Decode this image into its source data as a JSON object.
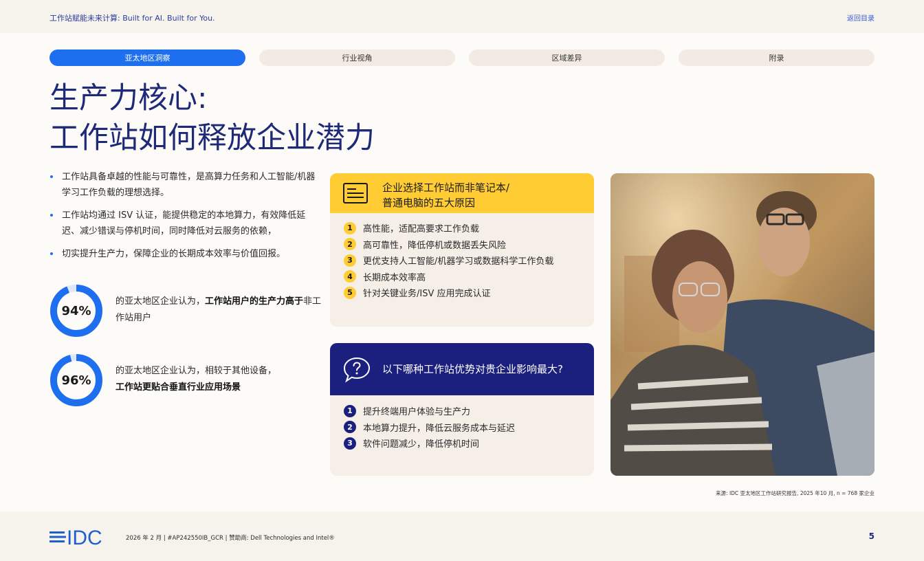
{
  "header": {
    "tagline": "工作站赋能未来计算: Built for AI. Built for You.",
    "back_link": "返回目录"
  },
  "tabs": [
    {
      "label": "亚太地区洞察",
      "active": true
    },
    {
      "label": "行业视角",
      "active": false
    },
    {
      "label": "区域差异",
      "active": false
    },
    {
      "label": "附录",
      "active": false
    }
  ],
  "title": {
    "line1": "生产力核心:",
    "line2": "工作站如何释放企业潜力"
  },
  "bullets": [
    "工作站具备卓越的性能与可靠性，是高算力任务和人工智能/机器学习工作负载的理想选择。",
    "工作站均通过 ISV 认证，能提供稳定的本地算力，有效降低延迟、减少错误与停机时间，同时降低对云服务的依赖，",
    "切实提升生产力，保障企业的长期成本效率与价值回报。"
  ],
  "stats": [
    {
      "value": "94%",
      "fraction": 0.94,
      "text_pre": "的亚太地区企业认为，",
      "text_bold1": "工作站用户的生产力高于",
      "text_post": "非工作站用户"
    },
    {
      "value": "96%",
      "fraction": 0.96,
      "text_pre": "的亚太地区企业认为，相较于其他设备，",
      "text_bold1": "工作站更贴合垂直行业应用场景",
      "text_post": ""
    }
  ],
  "card1": {
    "title_line1": "企业选择工作站而非笔记本/",
    "title_line2": "普通电脑的五大原因",
    "items": [
      {
        "num": "1",
        "text": "高性能，适配高要求工作负载"
      },
      {
        "num": "2",
        "text": "高可靠性，降低停机或数据丢失风险"
      },
      {
        "num": "3",
        "text": "更优支持人工智能/机器学习或数据科学工作负载"
      },
      {
        "num": "4",
        "text": "长期成本效率高"
      },
      {
        "num": "5",
        "text": "针对关键业务/ISV 应用完成认证"
      }
    ]
  },
  "card2": {
    "title": "以下哪种工作站优势对贵企业影响最大?",
    "items": [
      {
        "num": "1",
        "text": "提升终端用户体验与生产力"
      },
      {
        "num": "2",
        "text": "本地算力提升，降低云服务成本与延迟"
      },
      {
        "num": "3",
        "text": "软件问题减少，降低停机时间"
      }
    ]
  },
  "source": "来源: IDC 亚太地区工作站研究报告, 2025 年10 月, n = 768 家企业",
  "footer": {
    "logo_text": "IDC",
    "meta": "2026 年 2 月   |   #AP242550IB_GCR   |   赞助商: Dell Technologies and Intel®",
    "page": "5"
  },
  "colors": {
    "accent_blue": "#1e6ef0",
    "navy": "#1b1f7d",
    "yellow": "#ffcc33",
    "title": "#1e2a78"
  }
}
